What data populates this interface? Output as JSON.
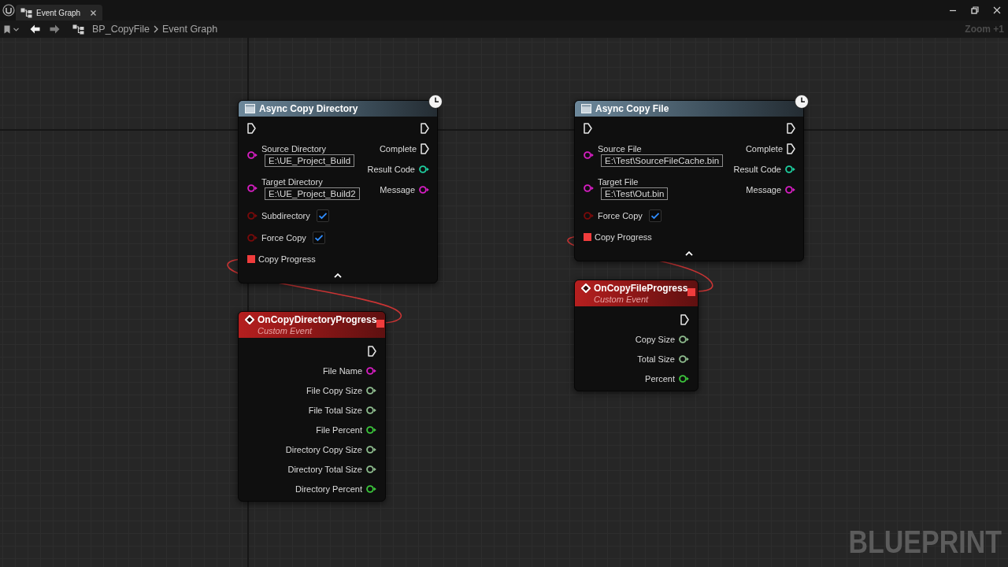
{
  "window": {
    "tab": {
      "title": "Event Graph",
      "selected": true
    }
  },
  "toolbar": {
    "navigation": [
      {
        "kind": "back",
        "disabled": false
      },
      {
        "kind": "forward",
        "disabled": true
      }
    ],
    "breadcrumb": [
      "BP_CopyFile",
      "Event Graph"
    ],
    "zoom": "Zoom +1"
  },
  "graph": {
    "nodes": [
      {
        "kind": "async",
        "title": "Async Copy Directory",
        "inputs": [
          {
            "kind": "exec"
          },
          {
            "kind": "string",
            "label": "Source Directory",
            "value": "E:\\UE_Project_Build"
          },
          {
            "kind": "string",
            "label": "Target Directory",
            "value": "E:\\UE_Project_Build2"
          },
          {
            "kind": "bool",
            "label": "Subdirectory",
            "checked": true
          },
          {
            "kind": "bool",
            "label": "Force Copy",
            "checked": true
          },
          {
            "kind": "delegate",
            "label": "Copy Progress",
            "connected": true
          }
        ],
        "outputs": [
          {
            "kind": "exec"
          },
          {
            "kind": "exec",
            "label": "Complete"
          },
          {
            "kind": "int",
            "label": "Result Code"
          },
          {
            "kind": "string",
            "label": "Message"
          }
        ],
        "advanced_expanded": true
      },
      {
        "kind": "event",
        "title": "OnCopyDirectoryProgress",
        "subtitle": "Custom Event",
        "delegate_connected": true,
        "outputs": [
          {
            "kind": "exec"
          },
          {
            "kind": "string",
            "label": "File Name"
          },
          {
            "kind": "int64",
            "label": "File Copy Size"
          },
          {
            "kind": "int64",
            "label": "File Total Size"
          },
          {
            "kind": "float",
            "label": "File Percent"
          },
          {
            "kind": "int64",
            "label": "Directory Copy Size"
          },
          {
            "kind": "int64",
            "label": "Directory Total Size"
          },
          {
            "kind": "float",
            "label": "Directory Percent"
          }
        ]
      },
      {
        "kind": "async",
        "title": "Async Copy File",
        "inputs": [
          {
            "kind": "exec"
          },
          {
            "kind": "string",
            "label": "Source File",
            "value": "E:\\Test\\SourceFileCache.bin"
          },
          {
            "kind": "string",
            "label": "Target File",
            "value": "E:\\Test\\Out.bin"
          },
          {
            "kind": "bool",
            "label": "Force Copy",
            "checked": true
          },
          {
            "kind": "delegate",
            "label": "Copy Progress",
            "connected": true
          }
        ],
        "outputs": [
          {
            "kind": "exec"
          },
          {
            "kind": "exec",
            "label": "Complete"
          },
          {
            "kind": "int",
            "label": "Result Code"
          },
          {
            "kind": "string",
            "label": "Message"
          }
        ],
        "advanced_expanded": true
      },
      {
        "kind": "event",
        "title": "OnCopyFileProgress",
        "subtitle": "Custom Event",
        "delegate_connected": true,
        "outputs": [
          {
            "kind": "exec"
          },
          {
            "kind": "int64",
            "label": "Copy Size"
          },
          {
            "kind": "int64",
            "label": "Total Size"
          },
          {
            "kind": "float",
            "label": "Percent"
          }
        ]
      }
    ],
    "graph_type_label": "BLUEPRINT"
  }
}
